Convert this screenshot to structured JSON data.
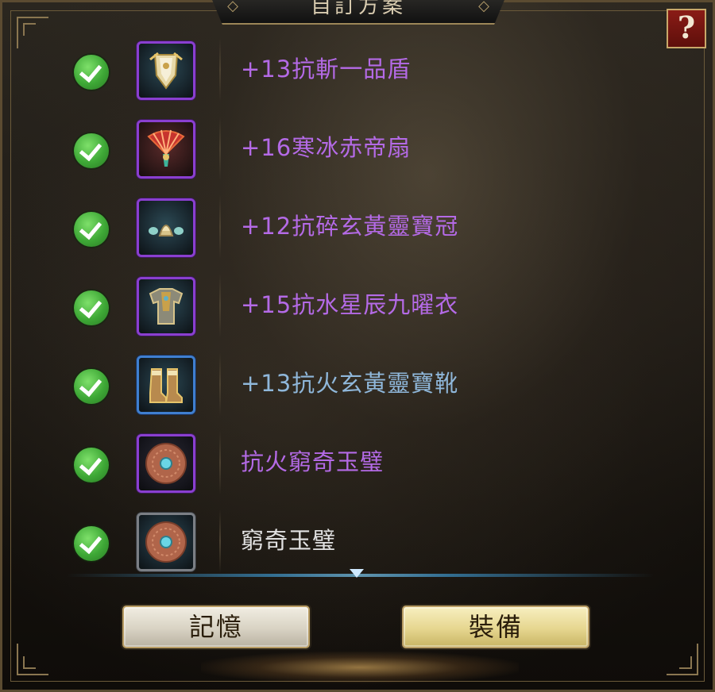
{
  "window": {
    "title": "自訂方案"
  },
  "help_button": {
    "label": "?"
  },
  "equipment": [
    {
      "name": "+13抗斬一品盾",
      "quality": "purple",
      "checked": true,
      "icon": "shield-icon"
    },
    {
      "name": "+16寒冰赤帝扇",
      "quality": "purple",
      "checked": true,
      "icon": "fan-icon"
    },
    {
      "name": "+12抗碎玄黃靈寶冠",
      "quality": "purple",
      "checked": true,
      "icon": "crown-icon"
    },
    {
      "name": "+15抗水星辰九曜衣",
      "quality": "purple",
      "checked": true,
      "icon": "armor-icon"
    },
    {
      "name": "+13抗火玄黃靈寶靴",
      "quality": "blue",
      "checked": true,
      "icon": "boots-icon"
    },
    {
      "name": "抗火窮奇玉璧",
      "quality": "purple",
      "checked": true,
      "icon": "jade-disc-icon"
    },
    {
      "name": "窮奇玉璧",
      "quality": "white",
      "checked": true,
      "icon": "jade-disc-icon"
    }
  ],
  "buttons": {
    "remember": "記憶",
    "equip": "裝備"
  },
  "colors": {
    "purple": "#b46ae6",
    "blue": "#8fb7da",
    "white": "#e2e2e2",
    "check": "#3ea836"
  }
}
